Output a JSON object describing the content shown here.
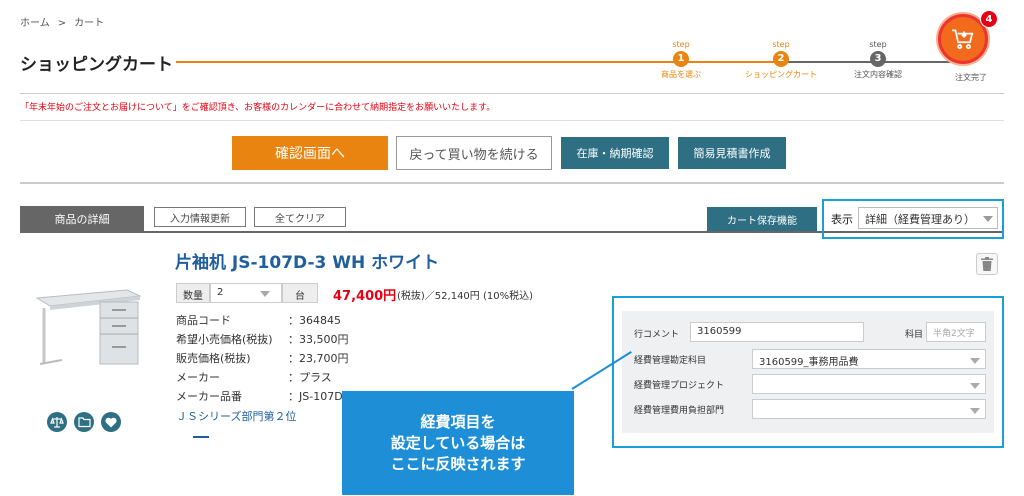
{
  "breadcrumb": {
    "home": "ホーム",
    "sep": ">",
    "current": "カート"
  },
  "page_title": "ショッピングカート",
  "steps": [
    {
      "label": "step",
      "num": "1",
      "name": "商品を選ぶ"
    },
    {
      "label": "step",
      "num": "2",
      "name": "ショッピングカート"
    },
    {
      "label": "step",
      "num": "3",
      "name": "注文内容確認"
    }
  ],
  "step_final": "注文完了",
  "cart_badge": "4",
  "notice": "「年末年始のご注文とお届けについて」をご確認頂き、お客様のカレンダーに合わせて納期指定をお願いいたします。",
  "buttons": {
    "confirm": "確認画面へ",
    "back": "戻って買い物を続ける",
    "stock": "在庫・納期確認",
    "quote": "簡易見積書作成",
    "update": "入力情報更新",
    "clear": "全てクリア",
    "save_cart": "カート保存機能"
  },
  "tab_detail": "商品の詳細",
  "display": {
    "label": "表示",
    "value": "詳細（経費管理あり）"
  },
  "product": {
    "title": "片袖机 JS-107D-3 WH ホワイト",
    "qty_label": "数量",
    "qty_value": "2",
    "qty_unit": "台",
    "price_main": "47,400円",
    "price_rest": "(税抜)／52,140円 (10%税込)",
    "info": [
      {
        "k": "商品コード",
        "v": "：364845"
      },
      {
        "k": "希望小売価格(税抜)",
        "v": "：33,500円"
      },
      {
        "k": "販売価格(税抜)",
        "v": "：23,700円"
      },
      {
        "k": "メーカー",
        "v": "：プラス"
      },
      {
        "k": "メーカー品番",
        "v": "：JS-107D"
      }
    ],
    "ranking": "ＪＳシリーズ部門第２位"
  },
  "expense": {
    "row_comment_label": "行コメント",
    "row_comment_value": "3160599",
    "subject_label": "科目",
    "subject_placeholder": "半角2文字",
    "account_label": "経費管理勘定科目",
    "account_value": "3160599_事務用品費",
    "project_label": "経費管理プロジェクト",
    "project_value": "",
    "dept_label": "経費管理費用負担部門",
    "dept_value": ""
  },
  "callout": {
    "line1": "経費項目を",
    "line2": "設定している場合は",
    "line3": "ここに反映されます"
  },
  "colors": {
    "accent": "#e8840f",
    "teal": "#2e6f83",
    "callout": "#1e8fd6",
    "price": "#e60012"
  }
}
